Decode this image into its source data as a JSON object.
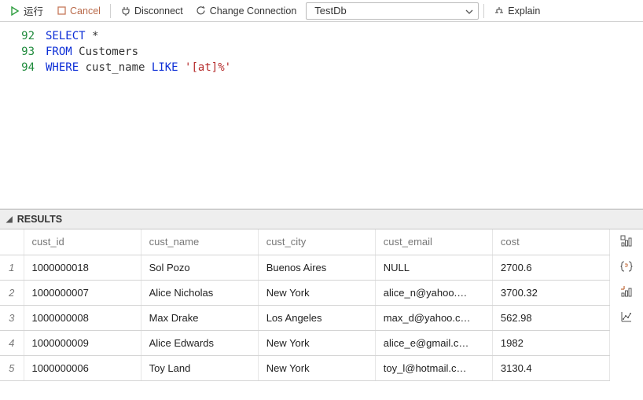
{
  "toolbar": {
    "run_label": "运行",
    "cancel_label": "Cancel",
    "disconnect_label": "Disconnect",
    "change_conn_label": "Change Connection",
    "db_selected": "TestDb",
    "explain_label": "Explain"
  },
  "editor": {
    "lines": [
      {
        "num": "92",
        "tokens": [
          {
            "t": "SELECT",
            "c": "kw"
          },
          {
            "t": " ",
            "c": "op"
          },
          {
            "t": "*",
            "c": "op"
          }
        ]
      },
      {
        "num": "93",
        "tokens": [
          {
            "t": "FROM",
            "c": "kw"
          },
          {
            "t": " ",
            "c": "op"
          },
          {
            "t": "Customers",
            "c": "ident"
          }
        ]
      },
      {
        "num": "94",
        "tokens": [
          {
            "t": "WHERE",
            "c": "kw"
          },
          {
            "t": " ",
            "c": "op"
          },
          {
            "t": "cust_name",
            "c": "ident"
          },
          {
            "t": " ",
            "c": "op"
          },
          {
            "t": "LIKE",
            "c": "kw"
          },
          {
            "t": " ",
            "c": "op"
          },
          {
            "t": "'[at]%'",
            "c": "str"
          }
        ]
      }
    ]
  },
  "results": {
    "title": "RESULTS",
    "columns": [
      "cust_id",
      "cust_name",
      "cust_city",
      "cust_email",
      "cost"
    ],
    "rows": [
      {
        "n": "1",
        "cells": [
          "1000000018",
          "Sol Pozo",
          "Buenos Aires",
          "NULL",
          "2700.6"
        ]
      },
      {
        "n": "2",
        "cells": [
          "1000000007",
          "Alice Nicholas",
          "New York",
          "alice_n@yahoo.…",
          "3700.32"
        ]
      },
      {
        "n": "3",
        "cells": [
          "1000000008",
          "Max Drake",
          "Los Angeles",
          "max_d@yahoo.c…",
          "562.98"
        ]
      },
      {
        "n": "4",
        "cells": [
          "1000000009",
          "Alice Edwards",
          "New York",
          "alice_e@gmail.c…",
          "1982"
        ]
      },
      {
        "n": "5",
        "cells": [
          "1000000006",
          "Toy Land",
          "New York",
          "toy_l@hotmail.c…",
          "3130.4"
        ]
      }
    ]
  }
}
